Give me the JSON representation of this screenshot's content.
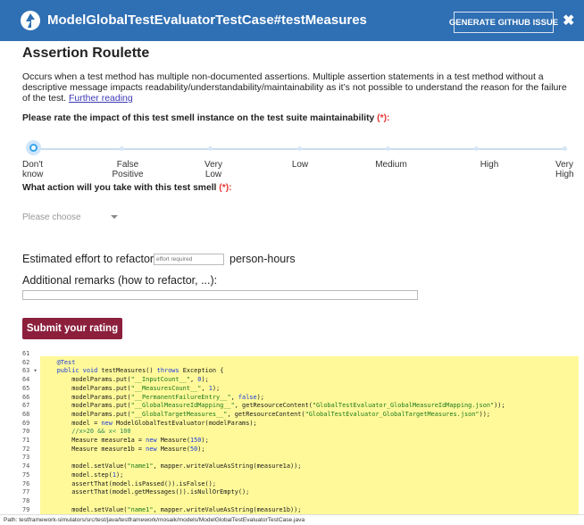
{
  "header": {
    "title": "ModelGlobalTestEvaluatorTestCase#testMeasures",
    "github_button": "GENERATE GITHUB ISSUE",
    "close": "✖"
  },
  "smell": {
    "title": "Assertion Roulette",
    "description": "Occurs when a test method has multiple non-documented assertions. Multiple assertion statements in a test method without a descriptive message impacts readability/understandability/maintainability as it’s not possible to understand the reason for the failure of the test.",
    "further_reading": "Further reading"
  },
  "rating": {
    "question": "Please rate the impact of this test smell instance on the test suite maintainability",
    "required": "(*):",
    "labels": [
      "Don't know",
      "False Positive",
      "Very Low",
      "Low",
      "Medium",
      "High",
      "Very High"
    ],
    "label_lines": [
      [
        "Don't",
        "know"
      ],
      [
        "False",
        "Positive"
      ],
      [
        "Very",
        "Low"
      ],
      [
        "Low",
        ""
      ],
      [
        "Medium",
        ""
      ],
      [
        "High",
        ""
      ],
      [
        "Very",
        "High"
      ]
    ],
    "selected_index": 0
  },
  "action": {
    "question": "What action will you take with this test smell",
    "required": "(*):",
    "select_placeholder": "Please choose"
  },
  "effort": {
    "label": "Estimated effort to refactor:",
    "placeholder": "effort required",
    "unit": "person-hours"
  },
  "remarks": {
    "label": "Additional remarks (how to refactor, ...):",
    "value": ""
  },
  "submit_label": "Submit your rating",
  "code": {
    "lines": [
      {
        "n": "61",
        "t": ""
      },
      {
        "n": "62",
        "t": "    @Test"
      },
      {
        "n": "63 ▾",
        "t": "    public void testMeasures() throws Exception {"
      },
      {
        "n": "64",
        "t": "        modelParams.put(\"__InputCount__\", 0);"
      },
      {
        "n": "65",
        "t": "        modelParams.put(\"__MeasuresCount__\", 1);"
      },
      {
        "n": "66",
        "t": "        modelParams.put(\"__PermanentFailureEntry__\", false);"
      },
      {
        "n": "67",
        "t": "        modelParams.put(\"__GlobalMeasureIdMapping__\", getResourceContent(\"GlobalTestEvaluator_GlobalMeasureIdMapping.json\"));"
      },
      {
        "n": "68",
        "t": "        modelParams.put(\"__GlobalTargetMeasures__\", getResourceContent(\"GlobalTestEvaluator_GlobalTargetMeasures.json\"));"
      },
      {
        "n": "69",
        "t": "        model = new ModelGlobalTestEvaluator(modelParams);"
      },
      {
        "n": "70",
        "t": "        //x>20 && x< 100"
      },
      {
        "n": "71",
        "t": "        Measure measure1a = new Measure(150);"
      },
      {
        "n": "72",
        "t": "        Measure measure1b = new Measure(50);"
      },
      {
        "n": "73",
        "t": ""
      },
      {
        "n": "74",
        "t": "        model.setValue(\"name1\", mapper.writeValueAsString(measure1a));"
      },
      {
        "n": "75",
        "t": "        model.step(1);"
      },
      {
        "n": "76",
        "t": "        assertThat(model.isPassed()).isFalse();"
      },
      {
        "n": "77",
        "t": "        assertThat(model.getMessages()).isNullOrEmpty();"
      },
      {
        "n": "78",
        "t": ""
      },
      {
        "n": "79",
        "t": "        model.setValue(\"name1\", mapper.writeValueAsString(measure1b));"
      }
    ]
  },
  "path": "Path: testframework-simulators/src/test/java/testframework/mosaik/models/ModelGlobalTestEvaluatorTestCase.java",
  "colors": {
    "header_bg": "#2f6fb3",
    "submit_bg": "#8b1f3c",
    "highlight": "#fff99a",
    "required": "#e8322f",
    "slider_knob": "#36a3ee"
  }
}
